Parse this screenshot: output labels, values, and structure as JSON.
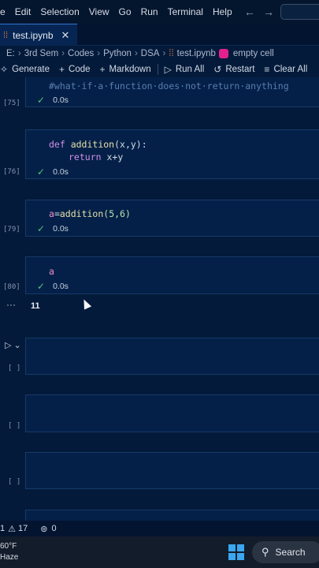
{
  "menu": [
    "e",
    "Edit",
    "Selection",
    "View",
    "Go",
    "Run",
    "Terminal",
    "Help"
  ],
  "nav": {
    "back": "←",
    "forward": "→"
  },
  "tab": {
    "label": "test.ipynb",
    "close": "✕"
  },
  "breadcrumb": {
    "parts": [
      "E:",
      "3rd Sem",
      "Codes",
      "Python",
      "DSA"
    ],
    "file": "test.ipynb",
    "cell": "empty cell",
    "sep": "›"
  },
  "toolbar": {
    "generate": "Generate",
    "code": "Code",
    "markdown": "Markdown",
    "run_all": "Run All",
    "restart": "Restart",
    "clear_all": "Clear All"
  },
  "cells": {
    "c75": {
      "count": "[75]",
      "code": "#what·if·a·function·does·not·return·anything",
      "time": "0.0s"
    },
    "c76": {
      "count": "[76]",
      "line1_kw": "def ",
      "line1_fn": "addition",
      "line1_rest": "(x,y):",
      "line2_kw": "return ",
      "line2_rest": "x+y",
      "time": "0.0s"
    },
    "c79": {
      "count": "[79]",
      "var": "a",
      "eq": "=",
      "fn": "addition",
      "args": "(5,6)",
      "time": "0.0s"
    },
    "c80": {
      "count": "[80]",
      "code": "a",
      "time": "0.0s",
      "output": "11",
      "dots": "···"
    },
    "e1": {
      "count": "[ ]"
    },
    "e2": {
      "count": "[ ]"
    },
    "e3": {
      "count": "[ ]"
    }
  },
  "statusbar": {
    "errors": "1",
    "warnings": "17",
    "ports": "0"
  },
  "taskbar": {
    "temp": "60°F",
    "weather": "Haze",
    "search": "Search"
  },
  "colors": {
    "accent": "#2b79d3",
    "check": "#56c27a",
    "cell_icon": "#e3208e",
    "notebook_icon": "#e07b3c"
  }
}
